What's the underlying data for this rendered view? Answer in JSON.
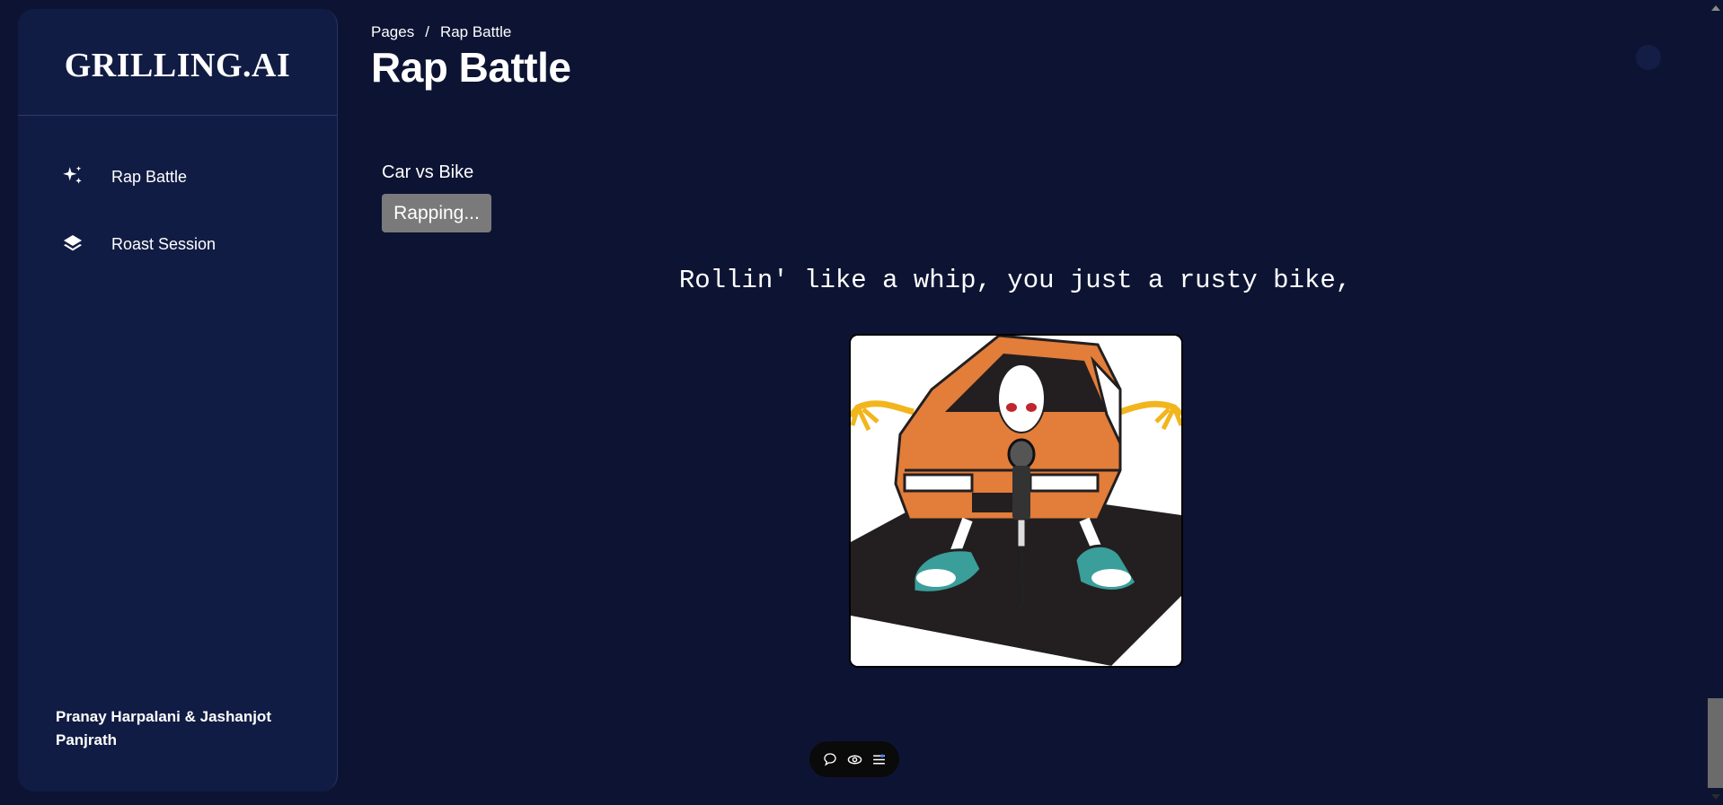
{
  "brand": {
    "name": "GRILLING.AI"
  },
  "sidebar": {
    "items": [
      {
        "label": "Rap Battle",
        "icon": "sparkles-icon"
      },
      {
        "label": "Roast Session",
        "icon": "layers-icon"
      }
    ],
    "authors": "Pranay Harpalani & Jashanjot Panjrath"
  },
  "header": {
    "breadcrumb_root": "Pages",
    "breadcrumb_sep": "/",
    "breadcrumb_current": "Rap Battle",
    "title": "Rap Battle"
  },
  "main": {
    "topic": "Car vs Bike",
    "button_label": "Rapping...",
    "lyric": "Rollin' like a whip, you just a rusty bike,",
    "image_alt": "cartoon-car-rapper-illustration"
  },
  "toolbar": {
    "icons": [
      "comment-icon",
      "eye-icon",
      "settings-list-icon"
    ]
  },
  "colors": {
    "background": "#0d1433",
    "sidebar": "#111c44",
    "button": "#7a7a7a",
    "car_orange": "#e27d3a",
    "shoe_teal": "#3a9e9a"
  }
}
